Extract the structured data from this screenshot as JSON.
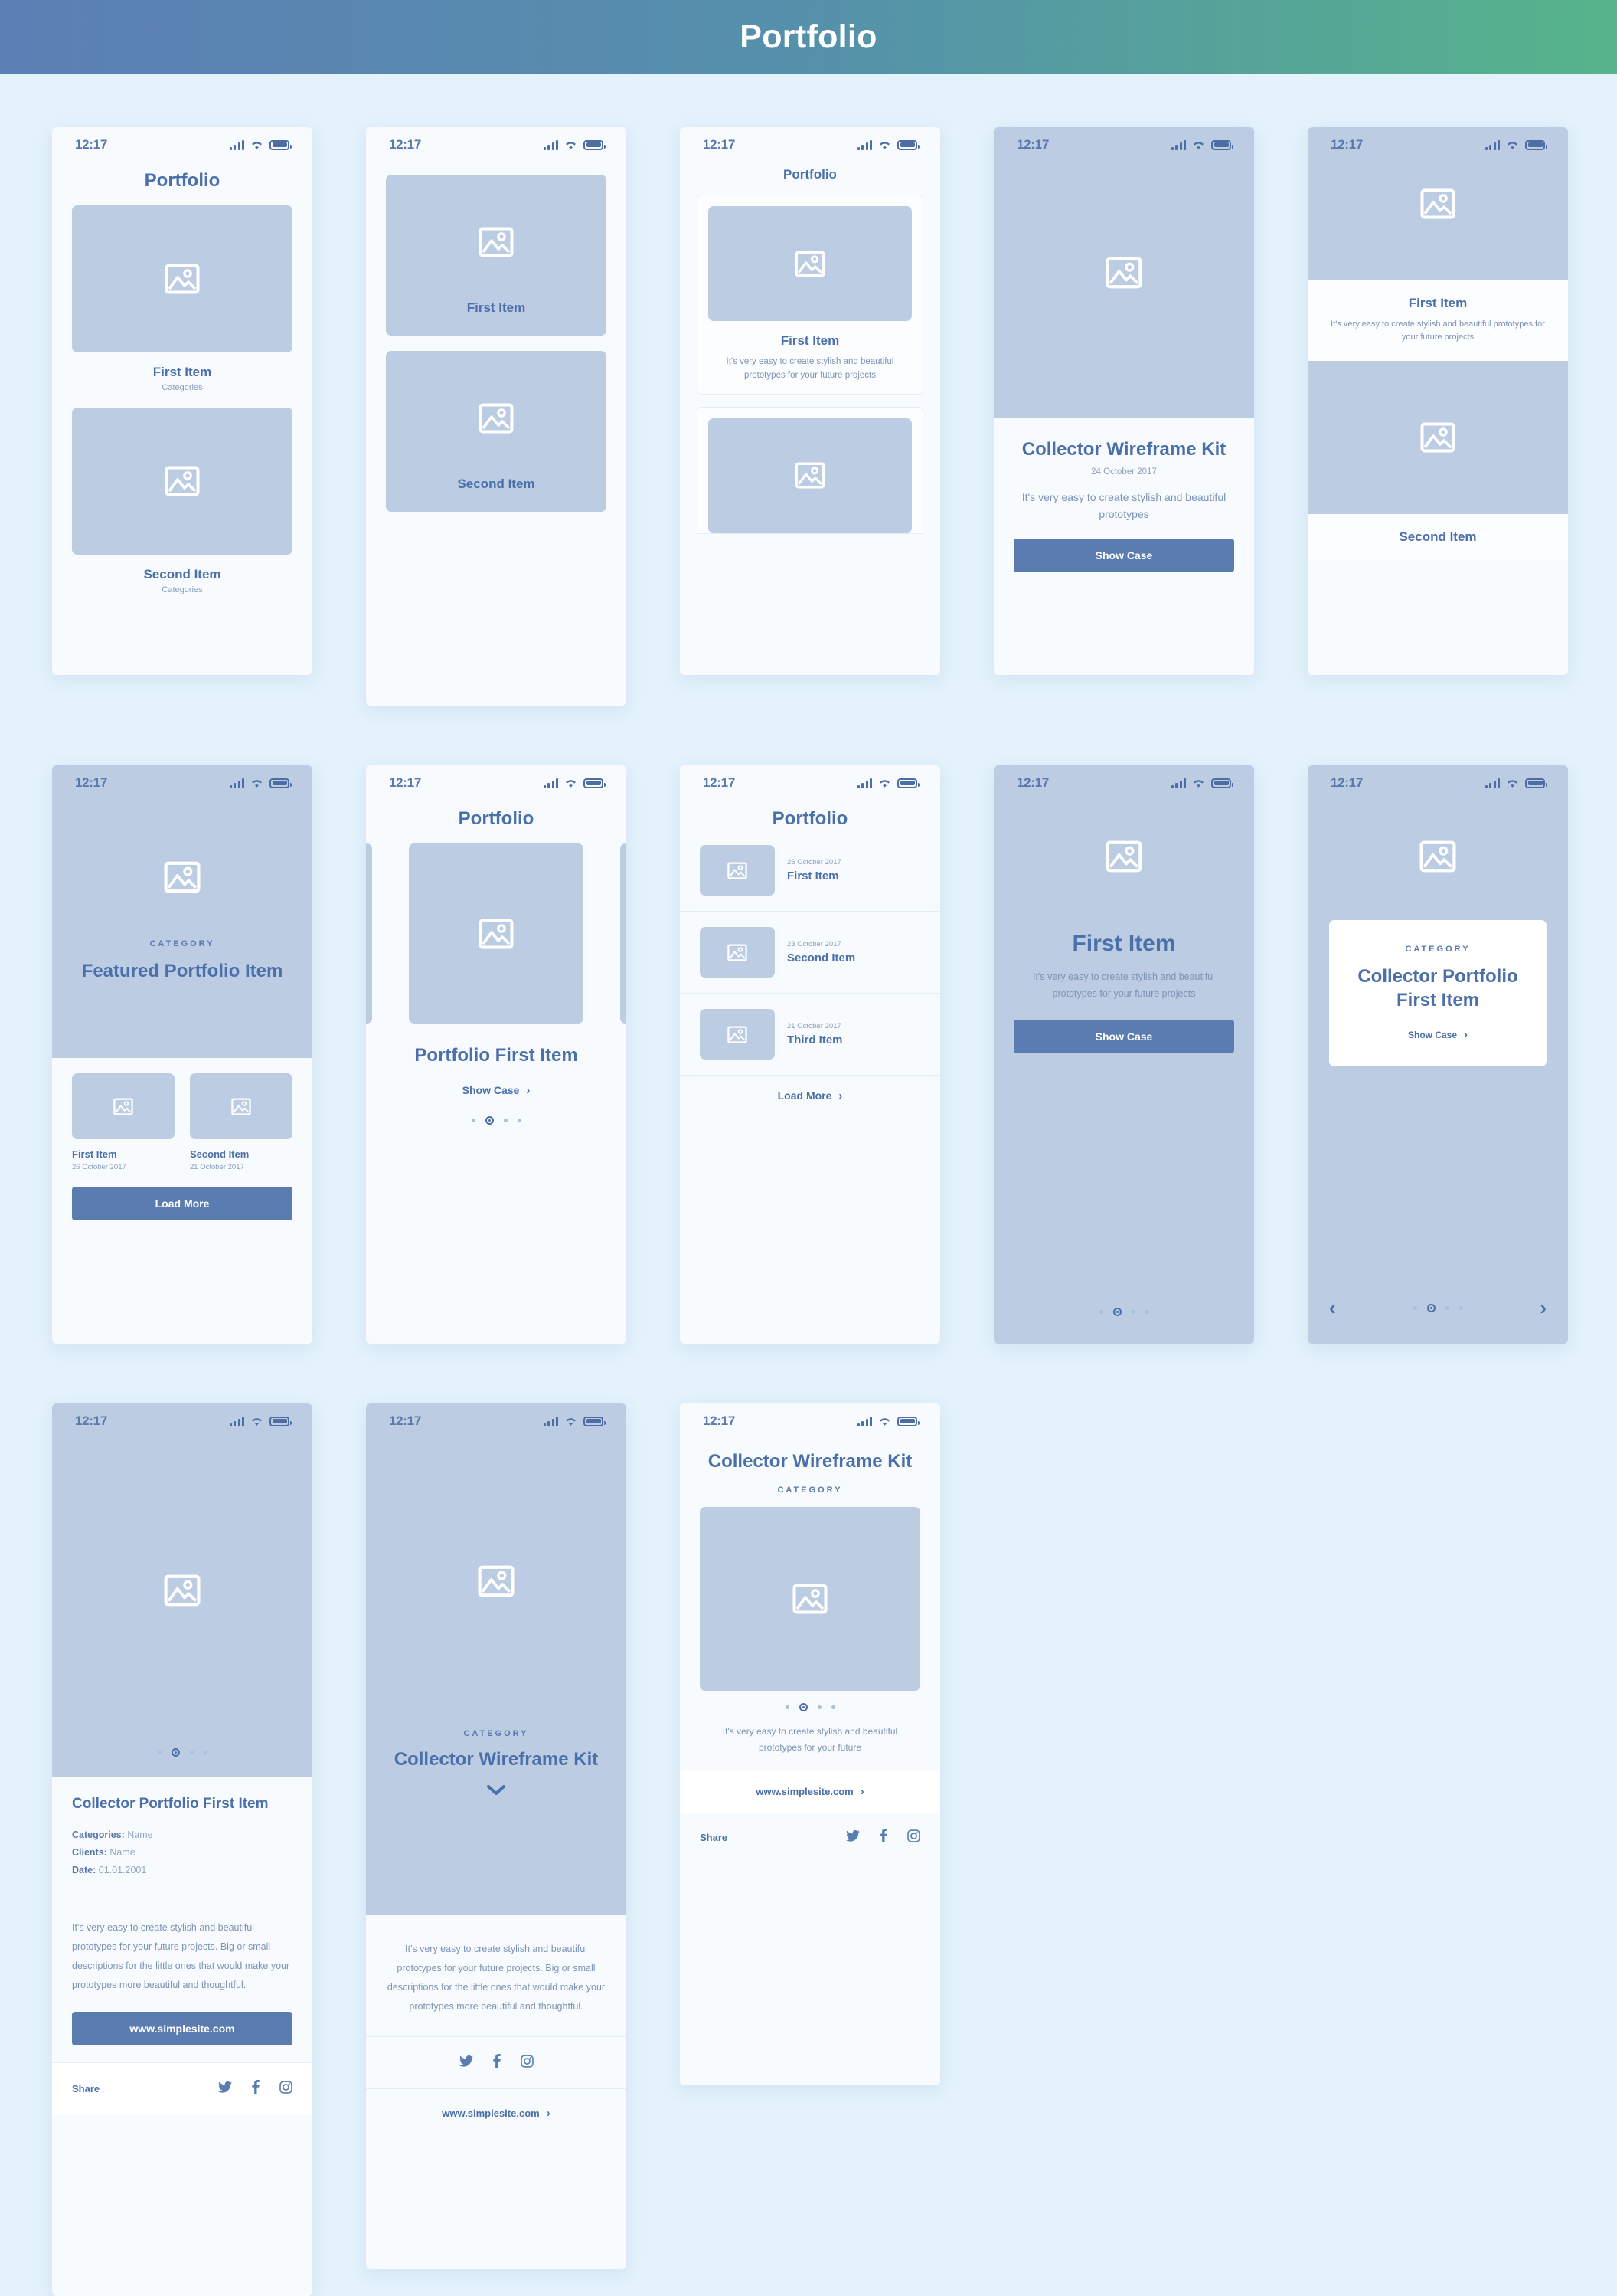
{
  "banner": {
    "title": "Portfolio"
  },
  "status": {
    "time": "12:17",
    "signal_icon": "signal-bars-icon",
    "wifi_icon": "wifi-icon",
    "battery_icon": "battery-icon"
  },
  "common": {
    "image_placeholder_icon": "image-placeholder-icon",
    "twitter_icon": "twitter-icon",
    "facebook_icon": "facebook-icon",
    "instagram_icon": "instagram-icon",
    "chevron_right": "›",
    "chevron_left": "‹",
    "chevron_down_icon": "chevron-down-icon",
    "share_label": "Share",
    "category_label": "CATEGORY",
    "website": "www.simplesite.com"
  },
  "screens": [
    {
      "id": "portfolio-grid-categories",
      "title": "Portfolio",
      "items": [
        {
          "name": "First Item",
          "sub": "Categories"
        },
        {
          "name": "Second Item",
          "sub": "Categories"
        }
      ]
    },
    {
      "id": "portfolio-stacked-tiles",
      "items": [
        {
          "name": "First Item"
        },
        {
          "name": "Second Item"
        }
      ]
    },
    {
      "id": "portfolio-cards-list",
      "title": "Portfolio",
      "items": [
        {
          "name": "First Item",
          "desc": "It's very easy to create stylish and beautiful prototypes for your future projects"
        },
        {
          "name": ""
        }
      ]
    },
    {
      "id": "collector-hero-showcase",
      "title": "Collector Wireframe Kit",
      "date": "24 October 2017",
      "desc": "It's very easy to create stylish and beautiful prototypes",
      "button": "Show Case"
    },
    {
      "id": "fullbleed-item-list",
      "items": [
        {
          "name": "First Item",
          "desc": "It's very easy to create stylish and beautiful prototypes for your future projects"
        },
        {
          "name": "Second Item"
        }
      ]
    },
    {
      "id": "featured-portfolio-item",
      "category": "CATEGORY",
      "title": "Featured Portfolio Item",
      "items": [
        {
          "name": "First Item",
          "date": "26 October 2017"
        },
        {
          "name": "Second Item",
          "date": "21 October 2017"
        }
      ],
      "button": "Load More"
    },
    {
      "id": "portfolio-carousel",
      "title": "Portfolio",
      "item_title": "Portfolio First Item",
      "link": "Show Case",
      "dots": 4,
      "active_dot": 1
    },
    {
      "id": "portfolio-dated-list",
      "title": "Portfolio",
      "rows": [
        {
          "date": "26 October 2017",
          "name": "First Item"
        },
        {
          "date": "23 October 2017",
          "name": "Second Item"
        },
        {
          "date": "21 October 2017",
          "name": "Third Item"
        }
      ],
      "footer_link": "Load More"
    },
    {
      "id": "first-item-flat-hero",
      "title": "First Item",
      "desc": "It's very easy to create stylish and beautiful prototypes for your future projects",
      "button": "Show Case",
      "dots": 4,
      "active_dot": 1
    },
    {
      "id": "collector-card-overlay",
      "category": "CATEGORY",
      "title": "Collector Portfolio First Item",
      "link": "Show Case",
      "dots": 4,
      "active_dot": 1,
      "prev_icon": "chevron-left-icon",
      "next_icon": "chevron-right-icon"
    },
    {
      "id": "collector-portfolio-detail",
      "title": "Collector Portfolio First Item",
      "fields": [
        {
          "label": "Categories:",
          "value": "Name"
        },
        {
          "label": "Clients:",
          "value": "Name"
        },
        {
          "label": "Date:",
          "value": "01.01.2001"
        }
      ],
      "body": "It's very easy to create stylish and beautiful prototypes for your future projects. Big or small descriptions for the little ones that would make your prototypes more beautiful and thoughtful.",
      "button": "www.simplesite.com",
      "share_label": "Share",
      "dots": 4,
      "active_dot": 1
    },
    {
      "id": "collector-kit-scroll",
      "category": "CATEGORY",
      "title": "Collector Wireframe Kit",
      "body": "It's very easy to create stylish and beautiful prototypes for your future projects. Big or small descriptions for the little ones that would make your prototypes more beautiful and thoughtful.",
      "footer_link": "www.simplesite.com"
    },
    {
      "id": "collector-kit-gallery",
      "title": "Collector Wireframe Kit",
      "category": "CATEGORY",
      "desc": "It's very easy to create stylish and beautiful prototypes for your future",
      "link": "www.simplesite.com",
      "share_label": "Share",
      "dots": 4,
      "active_dot": 1
    }
  ],
  "colors": {
    "bg": "#e3f2fb",
    "phone_bg": "#f7fbfe",
    "placeholder": "#bccde3",
    "accent": "#5a7cb1",
    "text": "#4b6fa8",
    "muted": "#7d93b6"
  }
}
